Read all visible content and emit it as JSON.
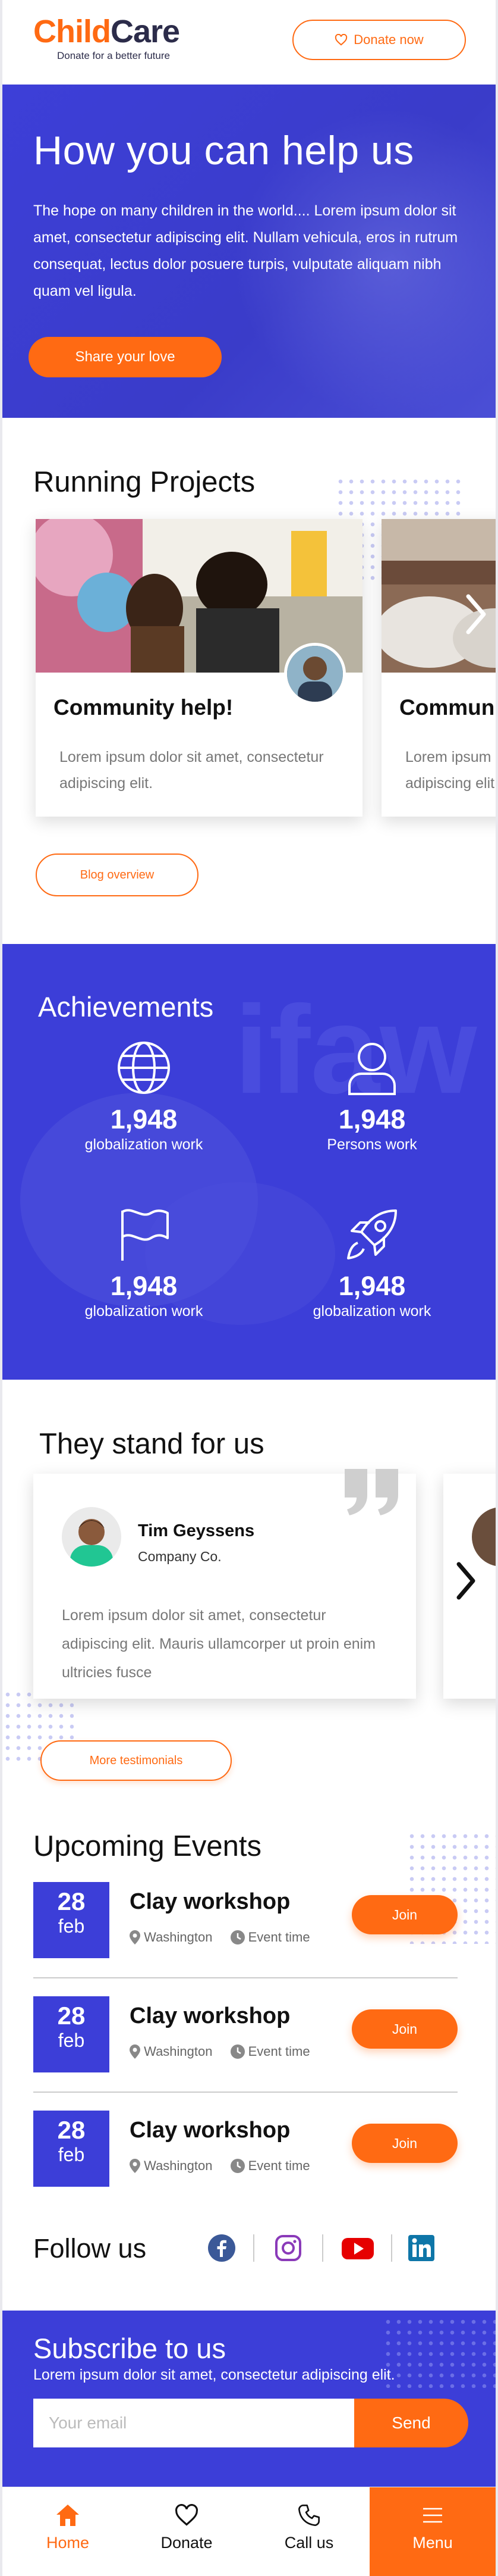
{
  "header": {
    "logo_part1": "Child",
    "logo_part2": "Care",
    "tagline": "Donate for a better future",
    "donate_label": "Donate now"
  },
  "hero": {
    "title": "How you can help us",
    "text": "The hope on many children in the world.... Lorem ipsum dolor sit amet, consectetur adipiscing elit. Nullam vehicula, eros in rutrum consequat, lectus dolor posuere turpis, vulputate aliquam nibh quam vel ligula.",
    "cta": "Share your love"
  },
  "projects": {
    "title": "Running Projects",
    "cards": [
      {
        "title": "Community help!",
        "desc": "Lorem ipsum dolor sit amet, consectetur adipiscing elit."
      },
      {
        "title": "Community help!",
        "desc": "Lorem ipsum dolor sit amet, consectetur adipiscing elit."
      }
    ],
    "button": "Blog overview"
  },
  "achievements": {
    "title": "Achievements",
    "items": [
      {
        "icon": "globe-icon",
        "value": "1,948",
        "label": "globalization work"
      },
      {
        "icon": "person-icon",
        "value": "1,948",
        "label": "Persons work"
      },
      {
        "icon": "flag-icon",
        "value": "1,948",
        "label": "globalization work"
      },
      {
        "icon": "rocket-icon",
        "value": "1,948",
        "label": "globalization work"
      }
    ]
  },
  "testimonials": {
    "title": "They stand for us",
    "card": {
      "name": "Tim Geyssens",
      "company": "Company Co.",
      "quote": "Lorem ipsum dolor sit amet, consectetur adipiscing elit. Mauris ullamcorper ut proin enim ultricies fusce"
    },
    "button": "More testimonials"
  },
  "events": {
    "title": "Upcoming Events",
    "items": [
      {
        "day": "28",
        "month": "feb",
        "title": "Clay workshop",
        "location": "Washington",
        "time": "Event time",
        "join": "Join"
      },
      {
        "day": "28",
        "month": "feb",
        "title": "Clay workshop",
        "location": "Washington",
        "time": "Event time",
        "join": "Join"
      },
      {
        "day": "28",
        "month": "feb",
        "title": "Clay workshop",
        "location": "Washington",
        "time": "Event time",
        "join": "Join"
      }
    ]
  },
  "follow": {
    "title": "Follow us",
    "networks": [
      "facebook-icon",
      "instagram-icon",
      "youtube-icon",
      "linkedin-icon"
    ]
  },
  "subscribe": {
    "title": "Subscribe to us",
    "text": "Lorem ipsum dolor sit amet, consectetur adipiscing elit.",
    "placeholder": "Your email",
    "button": "Send"
  },
  "nav": {
    "home": "Home",
    "donate": "Donate",
    "call": "Call us",
    "menu": "Menu"
  },
  "colors": {
    "accent": "#ff6a13",
    "brand_blue": "#3c3ed8",
    "dark": "#2c2c4a"
  }
}
